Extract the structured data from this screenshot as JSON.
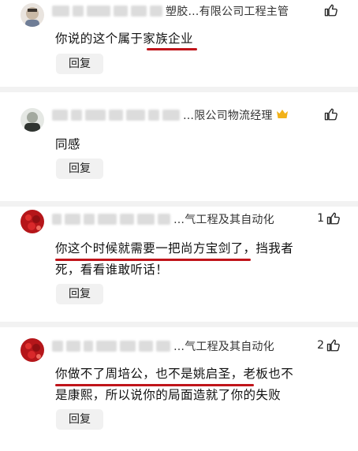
{
  "comments": [
    {
      "org": "塑胶…有限公司工程主管",
      "text": "你说的这个属于家族企业",
      "reply_label": "回复",
      "like_count": "",
      "avatar_color": "#c9b9a6",
      "has_crown": false
    },
    {
      "org": "…限公司物流经理",
      "text": "同感",
      "reply_label": "回复",
      "like_count": "",
      "avatar_color": "#8f9a8a",
      "has_crown": true
    },
    {
      "org": "…气工程及其自动化",
      "text_line1": "你这个时候就需要一把尚方宝剑了，挡我者",
      "text_line2": "死，看看谁敢听话！",
      "reply_label": "回复",
      "like_count": "1",
      "avatar_color": "#c8201d",
      "has_crown": false
    },
    {
      "org": "…气工程及其自动化",
      "text_line1": "你做不了周培公，也不是姚启圣，老板也不",
      "text_line2": "是康熙，所以说你的局面造就了你的失败",
      "reply_label": "回复",
      "like_count": "2",
      "avatar_color": "#c8201d",
      "has_crown": false
    }
  ],
  "icons": {
    "like": "thumbs-up-icon",
    "crown": "crown-icon"
  },
  "colors": {
    "underline": "#c0141a",
    "divider": "#f2f2f2",
    "reply_bg": "#f1f1f1"
  }
}
